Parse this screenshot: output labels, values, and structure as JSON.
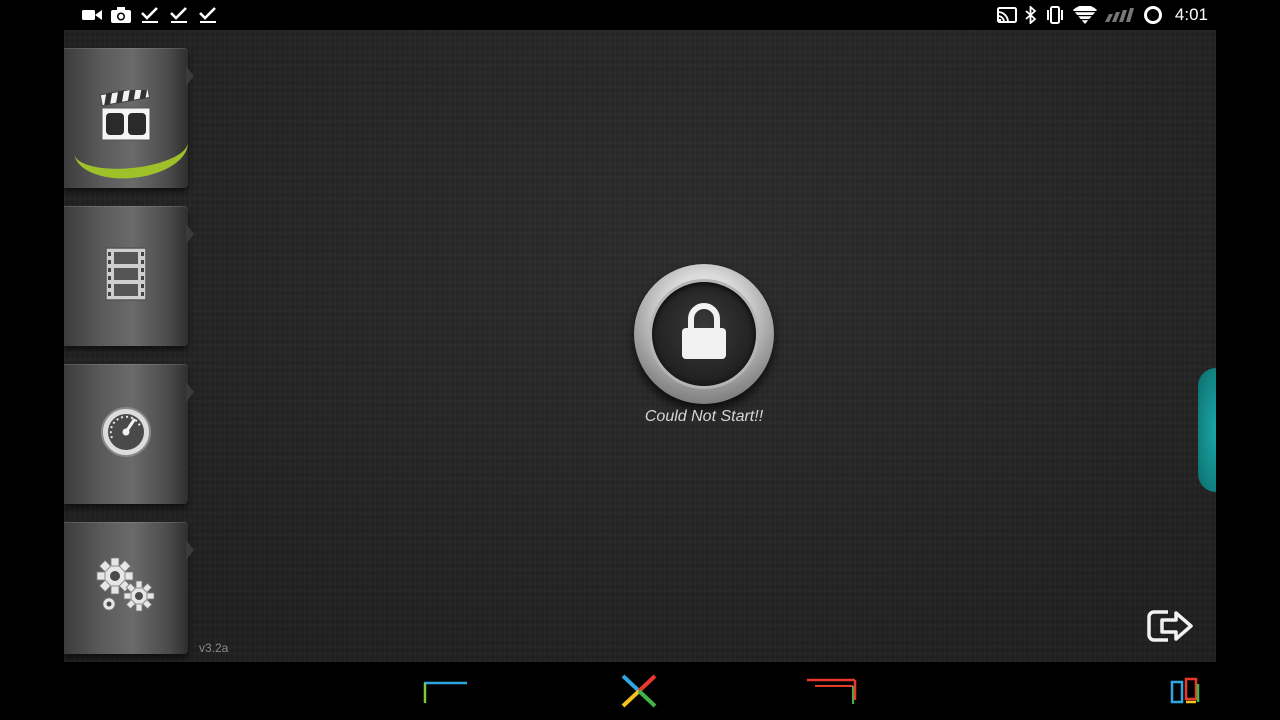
{
  "status_bar": {
    "time": "4:01",
    "left_icons": [
      "videocam-icon",
      "camera-icon",
      "check-icon",
      "check-icon",
      "check-icon"
    ],
    "right_icons": [
      "cast-icon",
      "bluetooth-icon",
      "vibrate-icon",
      "wifi-icon",
      "signal-icon",
      "circle-icon"
    ]
  },
  "sidebar": {
    "items": [
      {
        "name": "clapperboard-icon",
        "active": true
      },
      {
        "name": "film-strip-icon",
        "active": false
      },
      {
        "name": "speedometer-icon",
        "active": false
      },
      {
        "name": "gears-icon",
        "active": false
      }
    ],
    "active_color": "#9ec12a"
  },
  "main": {
    "status_message": "Could Not Start!!",
    "version": "v3.2a",
    "lock_icon": "lock-icon",
    "exit_icon": "exit-icon",
    "side_tab_color": "#138585"
  },
  "nav_bar": {
    "buttons": [
      "back-icon",
      "home-icon",
      "recent-apps-icon",
      "split-screen-icon"
    ]
  }
}
